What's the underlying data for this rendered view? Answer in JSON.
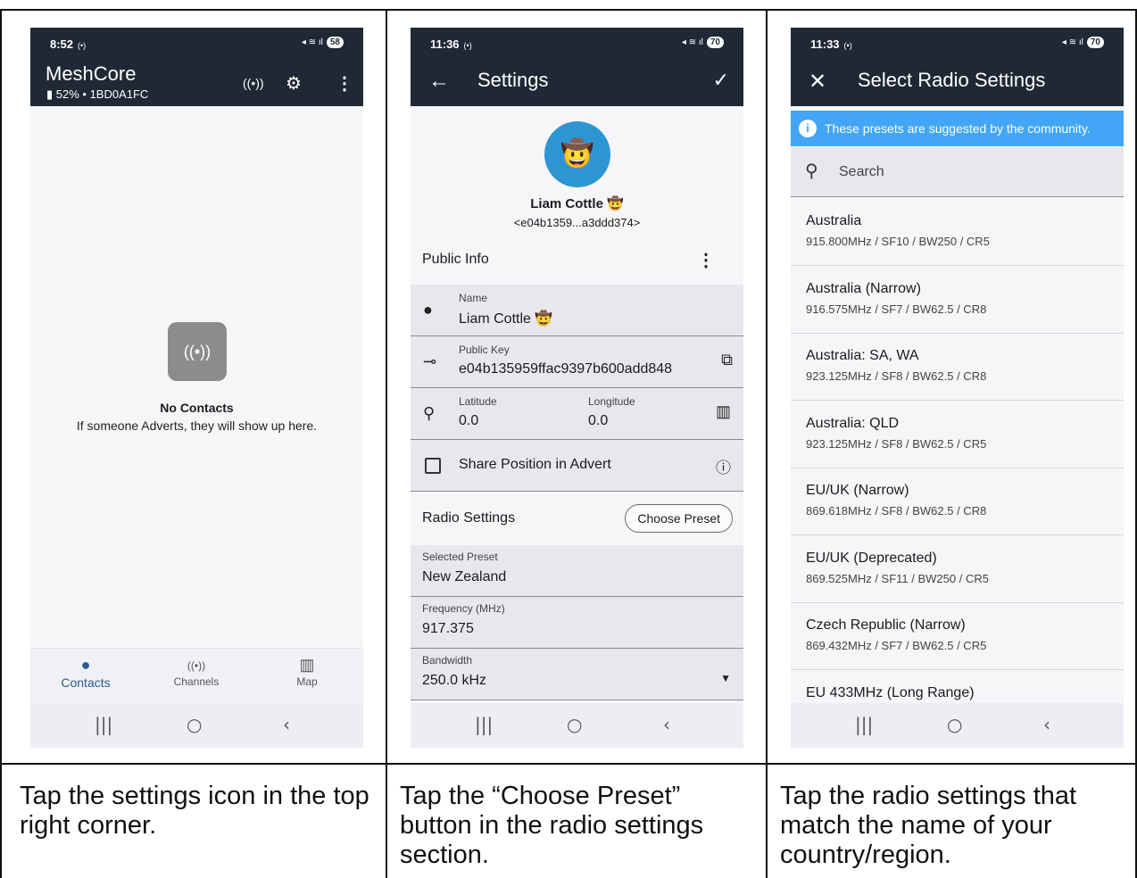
{
  "screens": [
    {
      "status_time": "8:52",
      "status_small": "(•)",
      "battery": "58",
      "app_title": "MeshCore",
      "app_subtitle": "52% • 1BD0A1FC",
      "empty_title": "No Contacts",
      "empty_subtitle": "If someone Adverts, they will show up here.",
      "nav": [
        {
          "label": "Contacts",
          "icon": "person-icon"
        },
        {
          "label": "Channels",
          "icon": "broadcast-icon"
        },
        {
          "label": "Map",
          "icon": "map-icon"
        }
      ]
    },
    {
      "status_time": "11:36",
      "status_small": "(•)",
      "battery": "70",
      "title": "Settings",
      "profile_name": "Liam Cottle 🤠",
      "profile_key": "<e04b1359...a3ddd374>",
      "public_info_label": "Public Info",
      "name_label": "Name",
      "name_value": "Liam Cottle 🤠",
      "pubkey_label": "Public Key",
      "pubkey_value": "e04b135959ffac9397b600add848",
      "lat_label": "Latitude",
      "lat_value": "0.0",
      "lon_label": "Longitude",
      "lon_value": "0.0",
      "share_label": "Share Position in Advert",
      "radio_label": "Radio Settings",
      "choose_preset": "Choose Preset",
      "preset_label": "Selected Preset",
      "preset_value": "New Zealand",
      "freq_label": "Frequency (MHz)",
      "freq_value": "917.375",
      "bw_label": "Bandwidth",
      "bw_value": "250.0 kHz"
    },
    {
      "status_time": "11:33",
      "status_small": "(•)",
      "battery": "70",
      "title": "Select Radio Settings",
      "info": "These presets are suggested by the community.",
      "search_placeholder": "Search",
      "presets": [
        {
          "name": "Australia",
          "detail": "915.800MHz / SF10 / BW250 / CR5"
        },
        {
          "name": "Australia (Narrow)",
          "detail": "916.575MHz / SF7 / BW62.5 / CR8"
        },
        {
          "name": "Australia: SA, WA",
          "detail": "923.125MHz / SF8 / BW62.5 / CR8"
        },
        {
          "name": "Australia: QLD",
          "detail": "923.125MHz / SF8 / BW62.5 / CR5"
        },
        {
          "name": "EU/UK (Narrow)",
          "detail": "869.618MHz / SF8 / BW62.5 / CR8"
        },
        {
          "name": "EU/UK (Deprecated)",
          "detail": "869.525MHz / SF11 / BW250 / CR5"
        },
        {
          "name": "Czech Republic (Narrow)",
          "detail": "869.432MHz / SF7 / BW62.5 / CR5"
        },
        {
          "name": "EU 433MHz (Long Range)",
          "detail": ""
        }
      ]
    }
  ],
  "captions": [
    "Tap the settings icon in the top right corner.",
    "Tap the “Choose Preset” button in the radio settings section.",
    "Tap the radio settings that match the name of your country/region."
  ],
  "colors": {
    "appbar": "#1f2935",
    "info": "#42a5f5",
    "accent": "#2b5a8f"
  }
}
